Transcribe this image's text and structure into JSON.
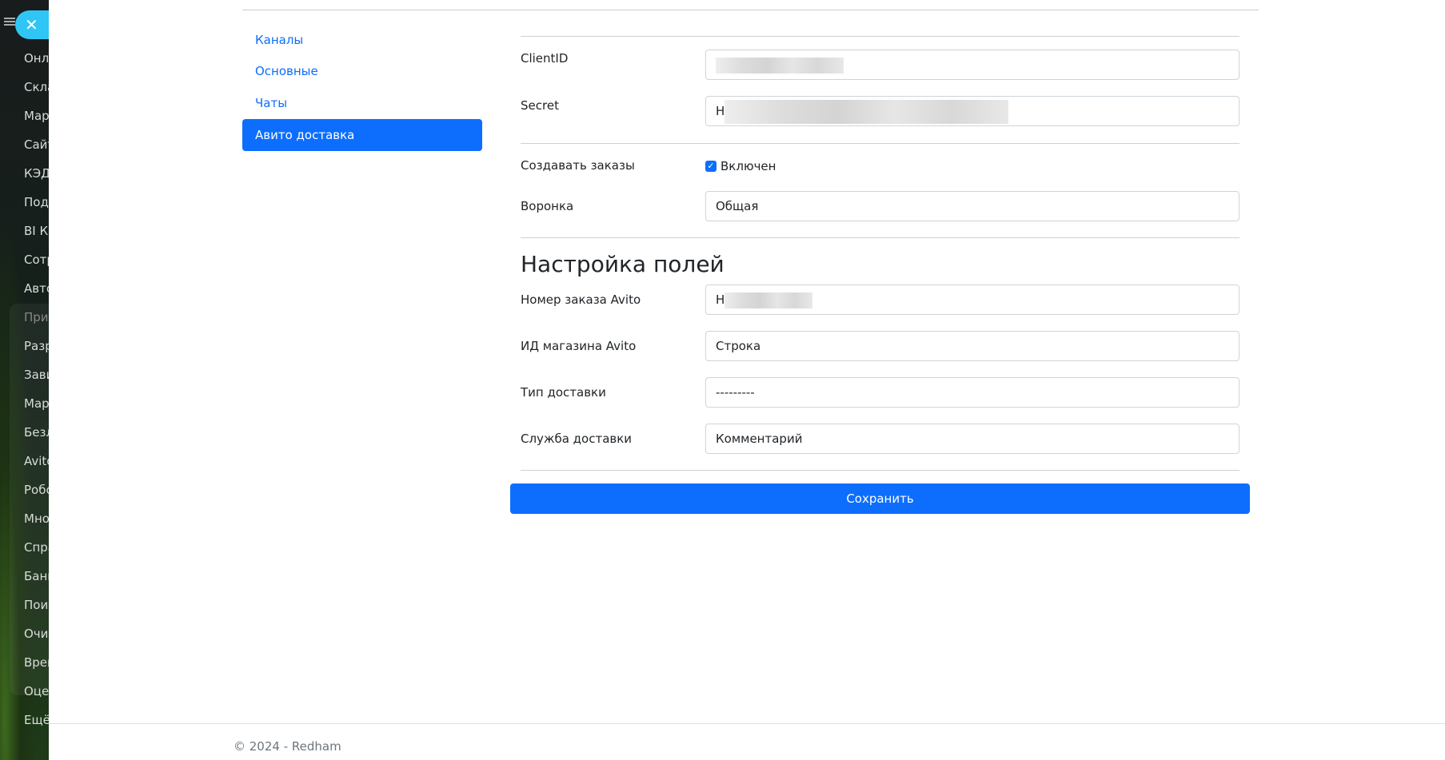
{
  "sidebar": {
    "items": [
      "Онла",
      "Скла",
      "Мар",
      "Сайт",
      "КЭД",
      "Подп",
      "BI Ко",
      "Сотр",
      "Авто",
      "Прил",
      "Разр",
      "Зави",
      "Мар",
      "Безл",
      "Avito",
      "Робо",
      "Мно",
      "Спра",
      "Банк",
      "Поис",
      "Очис",
      "Врем",
      "Оцен",
      "Ещё"
    ]
  },
  "nav": {
    "items": [
      "Каналы",
      "Основные",
      "Чаты",
      "Авито доставка"
    ],
    "active": 3
  },
  "form": {
    "client_id_label": "ClientID",
    "secret_label": "Secret",
    "secret_prefix": "Н",
    "create_orders_label": "Создавать заказы",
    "create_orders_checkbox": "Включен",
    "funnel_label": "Воронка",
    "funnel_value": "Общая",
    "section_title": "Настройка полей",
    "order_number_label": "Номер заказа Avito",
    "order_number_prefix": "Н",
    "shop_id_label": "ИД магазина Avito",
    "shop_id_value": "Строка",
    "delivery_type_label": "Тип доставки",
    "delivery_type_value": "---------",
    "delivery_service_label": "Служба доставки",
    "delivery_service_value": "Комментарий",
    "save_label": "Сохранить"
  },
  "footer": {
    "text": "© 2024 - Redham"
  }
}
